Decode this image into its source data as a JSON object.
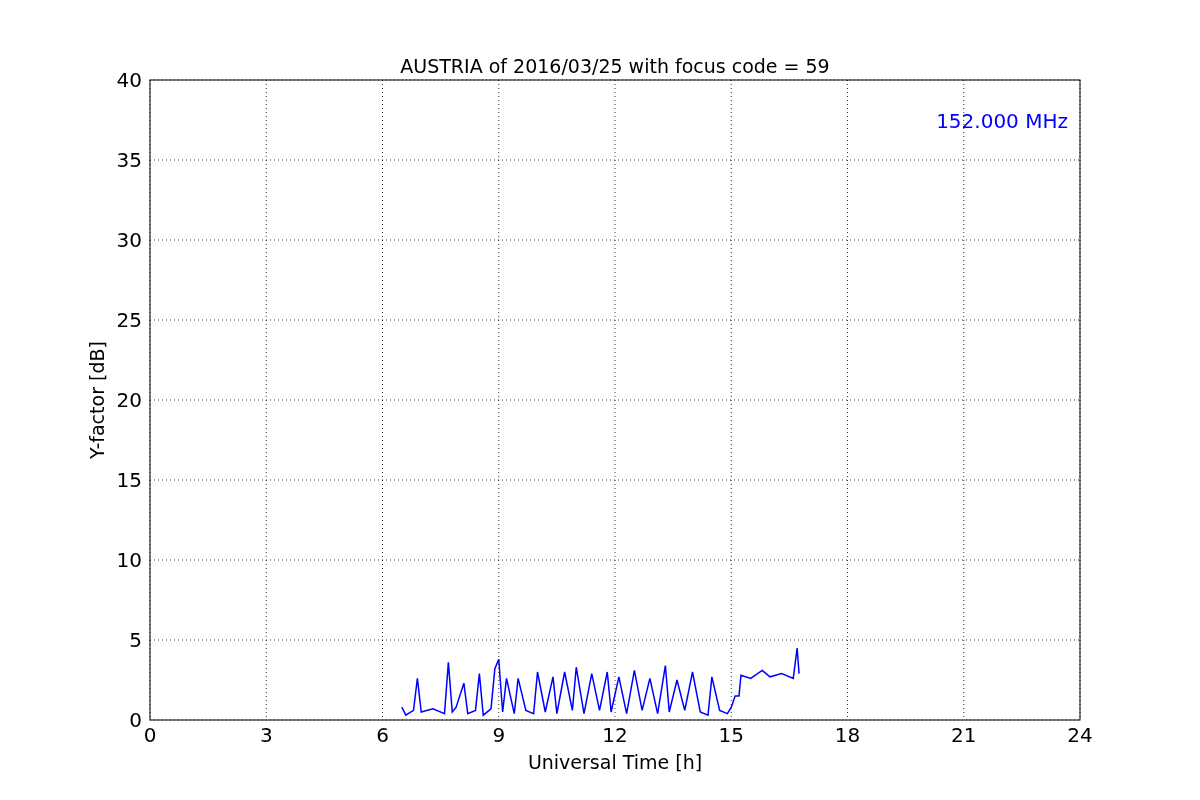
{
  "chart_data": {
    "type": "line",
    "title": "AUSTRIA of 2016/03/25 with focus code = 59",
    "xlabel": "Universal Time [h]",
    "ylabel": "Y-factor [dB]",
    "xlim": [
      0,
      24
    ],
    "ylim": [
      0,
      40
    ],
    "grid": true,
    "xticks": [
      0,
      3,
      6,
      9,
      12,
      15,
      18,
      21,
      24
    ],
    "yticks": [
      0,
      5,
      10,
      15,
      20,
      25,
      30,
      35,
      40
    ],
    "x": [
      6.5,
      6.6,
      6.8,
      6.9,
      7.0,
      7.3,
      7.6,
      7.7,
      7.8,
      7.9,
      8.1,
      8.2,
      8.4,
      8.5,
      8.6,
      8.8,
      8.9,
      9.0,
      9.1,
      9.2,
      9.4,
      9.5,
      9.7,
      9.9,
      10.0,
      10.2,
      10.4,
      10.5,
      10.7,
      10.9,
      11.0,
      11.2,
      11.4,
      11.6,
      11.8,
      11.9,
      12.1,
      12.3,
      12.5,
      12.7,
      12.9,
      13.1,
      13.3,
      13.4,
      13.6,
      13.8,
      14.0,
      14.2,
      14.4,
      14.5,
      14.7,
      14.9,
      15.0,
      15.1,
      15.2,
      15.25,
      15.5,
      15.8,
      16.0,
      16.3,
      16.6,
      16.7,
      16.75
    ],
    "series": [
      {
        "name": "152.000 MHz",
        "color": "#0000ff",
        "values": [
          0.8,
          0.3,
          0.6,
          2.6,
          0.5,
          0.7,
          0.4,
          3.6,
          0.5,
          0.8,
          2.3,
          0.4,
          0.6,
          2.9,
          0.3,
          0.7,
          3.2,
          3.8,
          0.5,
          2.6,
          0.4,
          2.6,
          0.6,
          0.4,
          3.0,
          0.5,
          2.7,
          0.4,
          3.0,
          0.6,
          3.3,
          0.4,
          2.9,
          0.6,
          3.0,
          0.5,
          2.7,
          0.4,
          3.1,
          0.6,
          2.6,
          0.4,
          3.4,
          0.5,
          2.5,
          0.6,
          3.0,
          0.5,
          0.3,
          2.7,
          0.6,
          0.4,
          0.8,
          1.5,
          1.5,
          2.8,
          2.6,
          3.1,
          2.7,
          2.9,
          2.6,
          4.5,
          2.9
        ]
      }
    ]
  }
}
